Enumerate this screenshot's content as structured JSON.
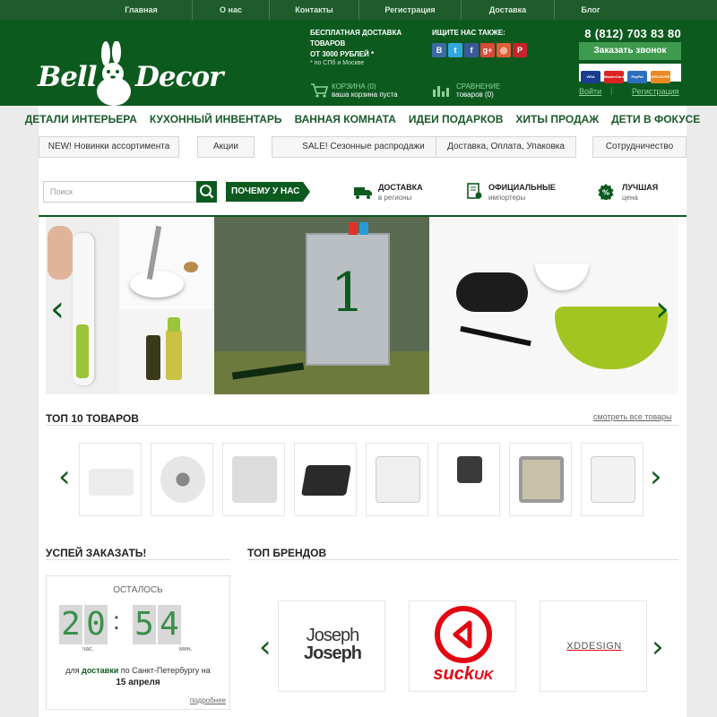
{
  "topmenu": [
    "Главная",
    "О нас",
    "Контакты",
    "Регистрация",
    "Доставка",
    "Блог"
  ],
  "logo": {
    "left": "Bell",
    "right": "Decor"
  },
  "delivery": {
    "line1": "БЕСПЛАТНАЯ ДОСТАВКА ТОВАРОВ",
    "line2": "ОТ 3000 РУБЛЕЙ *",
    "note": "* по СПб и Москве"
  },
  "social": {
    "title": "ИЩИТЕ НАС ТАКЖЕ:",
    "icons": [
      "B",
      "t",
      "f",
      "g+",
      "◎",
      "P"
    ]
  },
  "cart": {
    "label": "КОРЗИНА (0)",
    "sub": "ваша корзина пуста"
  },
  "compare": {
    "label": "СРАВНЕНИЕ",
    "sub": "товаров (0)"
  },
  "phone": "8 (812) 703 83 80",
  "call_button": "Заказать звонок",
  "payments": [
    "VISA",
    "MasterCard",
    "PayPal",
    "DISCOVER"
  ],
  "auth": {
    "login": "Войти",
    "register": "Регистрация"
  },
  "catnav": [
    "ДЕТАЛИ ИНТЕРЬЕРА",
    "КУХОННЫЙ ИНВЕНТАРЬ",
    "ВАННАЯ КОМНАТА",
    "ИДЕИ ПОДАРКОВ",
    "ХИТЫ ПРОДАЖ",
    "ДЕТИ В ФОКУСЕ"
  ],
  "subnav": [
    "NEW! Новинки ассортимента",
    "Акции",
    "SALE! Сезонные распродажи",
    "Доставка, Оплата, Упаковка",
    "Сотрудничество"
  ],
  "search": {
    "placeholder": "Поиск"
  },
  "whyus": "ПОЧЕМУ У НАС",
  "features": [
    {
      "title": "ДОСТАВКА",
      "sub": "в регионы"
    },
    {
      "title": "ОФИЦИАЛЬНЫЕ",
      "sub": "импортеры"
    },
    {
      "title": "ЛУЧШАЯ",
      "sub": "цена"
    }
  ],
  "slide_number": "1",
  "top10": {
    "title": "ТОП 10 ТОВАРОВ",
    "link": "смотреть все товары"
  },
  "hurry": {
    "title": "УСПЕЙ ЗАКАЗАТЬ!",
    "left": "ОСТАЛОСЬ",
    "h1": "2",
    "h2": "0",
    "m1": "5",
    "m2": "4",
    "sep": ":",
    "hours": "час.",
    "mins": "мин.",
    "line1a": "для ",
    "line1b": "доставки",
    "line1c": " по Санкт-Петербургу на",
    "date": "15 апреля",
    "more": "подробнее"
  },
  "brands": {
    "title": "ТОП БРЕНДОВ",
    "items": [
      {
        "l1": "Joseph",
        "l2": "Joseph"
      },
      {
        "name": "suck",
        "suffix": "UK"
      },
      {
        "name": "XDDESIGN"
      }
    ]
  },
  "colors": {
    "header": "#0d5a1f",
    "accent": "#3d9a4e"
  }
}
